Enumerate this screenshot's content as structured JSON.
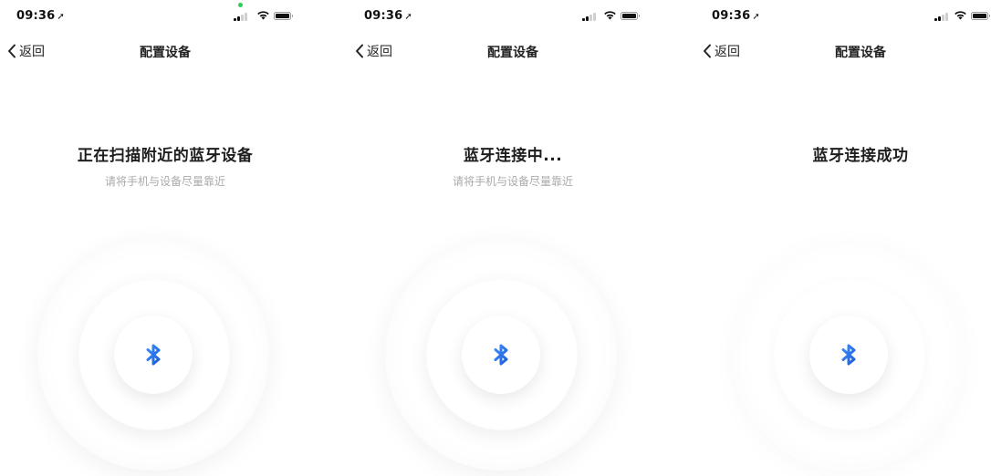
{
  "screens": [
    {
      "status": {
        "time": "09:36",
        "location_arrow": "➚"
      },
      "nav": {
        "back_label": "返回",
        "title": "配置设备"
      },
      "main": {
        "heading": "正在扫描附近的蓝牙设备",
        "hint": "请将手机与设备尽量靠近"
      },
      "icon": "bluetooth-icon"
    },
    {
      "status": {
        "time": "09:36",
        "location_arrow": "➚"
      },
      "nav": {
        "back_label": "返回",
        "title": "配置设备"
      },
      "main": {
        "heading": "蓝牙连接中...",
        "hint": "请将手机与设备尽量靠近"
      },
      "icon": "bluetooth-icon"
    },
    {
      "status": {
        "time": "09:36",
        "location_arrow": "➚"
      },
      "nav": {
        "back_label": "返回",
        "title": "配置设备"
      },
      "main": {
        "heading": "蓝牙连接成功"
      },
      "icon": "bluetooth-icon"
    }
  ],
  "colors": {
    "bluetooth_accent": "#2f7bf0",
    "recording_dot": "#2ecc59",
    "hint_text": "#aaaaaa"
  }
}
